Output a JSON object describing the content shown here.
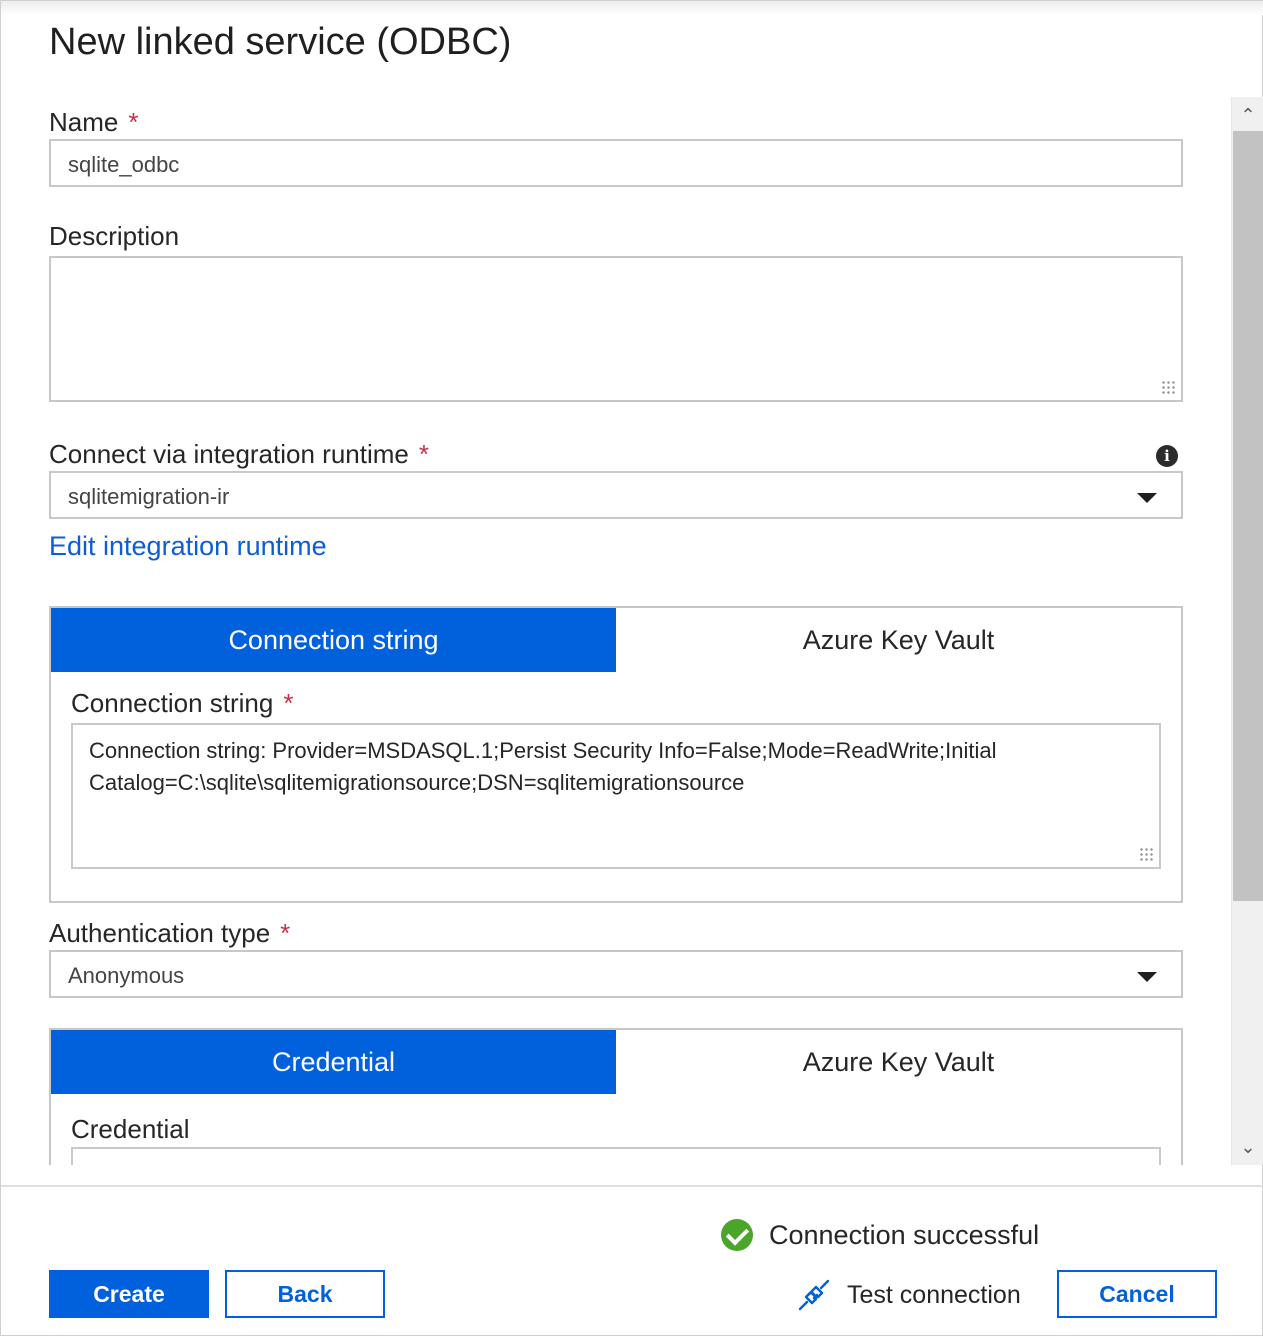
{
  "dialog": {
    "title": "New linked service (ODBC)"
  },
  "form": {
    "name": {
      "label": "Name",
      "required_mark": "*",
      "value": "sqlite_odbc"
    },
    "description": {
      "label": "Description",
      "value": ""
    },
    "integration_runtime": {
      "label": "Connect via integration runtime",
      "required_mark": "*",
      "value": "sqlitemigration-ir",
      "info_icon": "info-icon"
    },
    "edit_runtime_link": "Edit integration runtime",
    "connection_tabs": [
      {
        "label": "Connection string",
        "active": true
      },
      {
        "label": "Azure Key Vault",
        "active": false
      }
    ],
    "connection_string": {
      "label": "Connection string",
      "required_mark": "*",
      "value": "Connection string: Provider=MSDASQL.1;Persist Security Info=False;Mode=ReadWrite;Initial Catalog=C:\\sqlite\\sqlitemigrationsource;DSN=sqlitemigrationsource"
    },
    "authentication_type": {
      "label": "Authentication type",
      "required_mark": "*",
      "value": "Anonymous"
    },
    "credential_tabs": [
      {
        "label": "Credential",
        "active": true
      },
      {
        "label": "Azure Key Vault",
        "active": false
      }
    ],
    "credential": {
      "label": "Credential"
    }
  },
  "footer": {
    "status_text": "Connection successful",
    "test_connection": "Test connection",
    "create": "Create",
    "back": "Back",
    "cancel": "Cancel"
  },
  "colors": {
    "accent": "#0160dc",
    "success": "#4aa52a",
    "required": "#c4314b",
    "link": "#0b5ed7"
  }
}
